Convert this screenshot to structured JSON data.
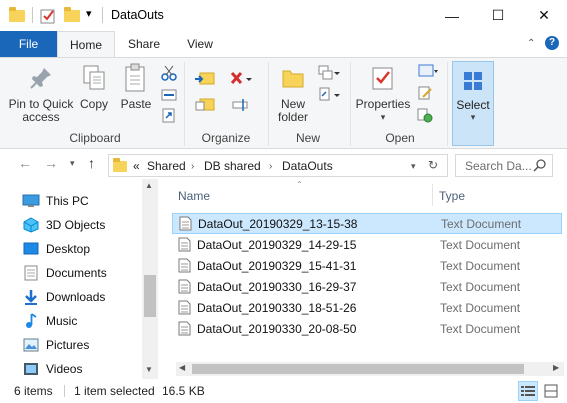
{
  "window": {
    "title": "DataOuts",
    "qa_customize": "▾",
    "minimize": "—",
    "maximize": "☐",
    "close": "✕"
  },
  "ribbon_tabs": {
    "file": "File",
    "home": "Home",
    "share": "Share",
    "view": "View"
  },
  "ribbon": {
    "clipboard": {
      "pin_line1": "Pin to Quick",
      "pin_line2": "access",
      "copy": "Copy",
      "paste": "Paste",
      "label": "Clipboard"
    },
    "organize": {
      "label": "Organize"
    },
    "new": {
      "new_folder_line1": "New",
      "new_folder_line2": "folder",
      "label": "New"
    },
    "open": {
      "properties": "Properties",
      "label": "Open"
    },
    "select": {
      "label": "Select"
    }
  },
  "address": {
    "prefix": "«",
    "crumbs": [
      "Shared",
      "DB shared",
      "DataOuts"
    ],
    "search_placeholder": "Search Da..."
  },
  "nav": {
    "items": [
      "This PC",
      "3D Objects",
      "Desktop",
      "Documents",
      "Downloads",
      "Music",
      "Pictures",
      "Videos"
    ]
  },
  "files": {
    "col_name": "Name",
    "col_type": "Type",
    "rows": [
      {
        "name": "DataOut_20190329_13-15-38",
        "type": "Text Document",
        "selected": true
      },
      {
        "name": "DataOut_20190329_14-29-15",
        "type": "Text Document",
        "selected": false
      },
      {
        "name": "DataOut_20190329_15-41-31",
        "type": "Text Document",
        "selected": false
      },
      {
        "name": "DataOut_20190330_16-29-37",
        "type": "Text Document",
        "selected": false
      },
      {
        "name": "DataOut_20190330_18-51-26",
        "type": "Text Document",
        "selected": false
      },
      {
        "name": "DataOut_20190330_20-08-50",
        "type": "Text Document",
        "selected": false
      }
    ]
  },
  "status": {
    "item_count": "6 items",
    "selected": "1 item selected",
    "size": "16.5 KB"
  },
  "colors": {
    "accent": "#1a66b8",
    "selection": "#cce8ff",
    "folder": "#f7d359"
  }
}
